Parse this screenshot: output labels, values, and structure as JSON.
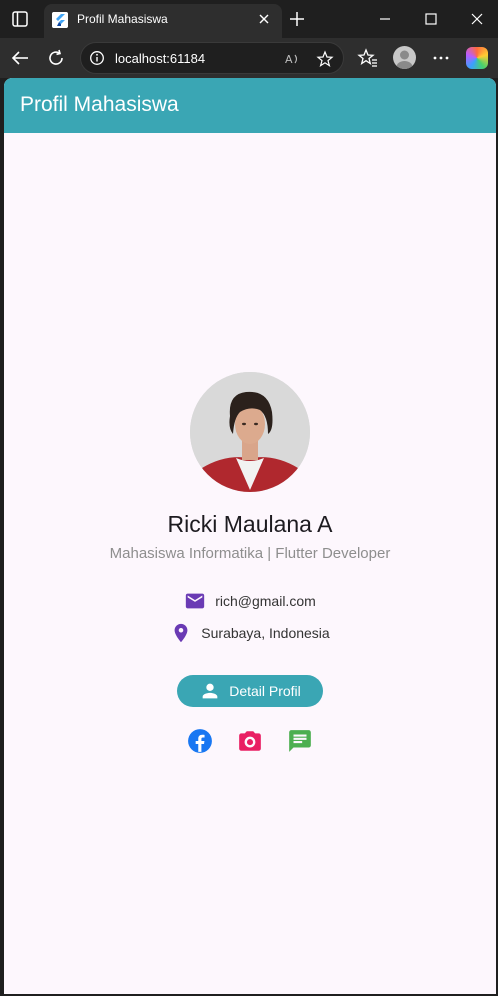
{
  "browser": {
    "tab_title": "Profil Mahasiswa",
    "address": "localhost:61184"
  },
  "app": {
    "title": "Profil Mahasiswa",
    "accent_color": "#3aa6b4"
  },
  "profile": {
    "name": "Ricki Maulana A",
    "subtitle": "Mahasiswa Informatika | Flutter Developer",
    "email": "rich@gmail.com",
    "location": "Surabaya, Indonesia",
    "detail_button_label": "Detail Profil"
  },
  "icons": {
    "email": "email-icon",
    "location": "location-pin-icon",
    "person": "person-icon",
    "facebook": "facebook-icon",
    "camera": "camera-icon",
    "chat": "chat-icon"
  },
  "colors": {
    "icon_purple": "#6a3ab4",
    "facebook": "#1877f2",
    "camera": "#e91e63",
    "chat": "#4caf50"
  }
}
